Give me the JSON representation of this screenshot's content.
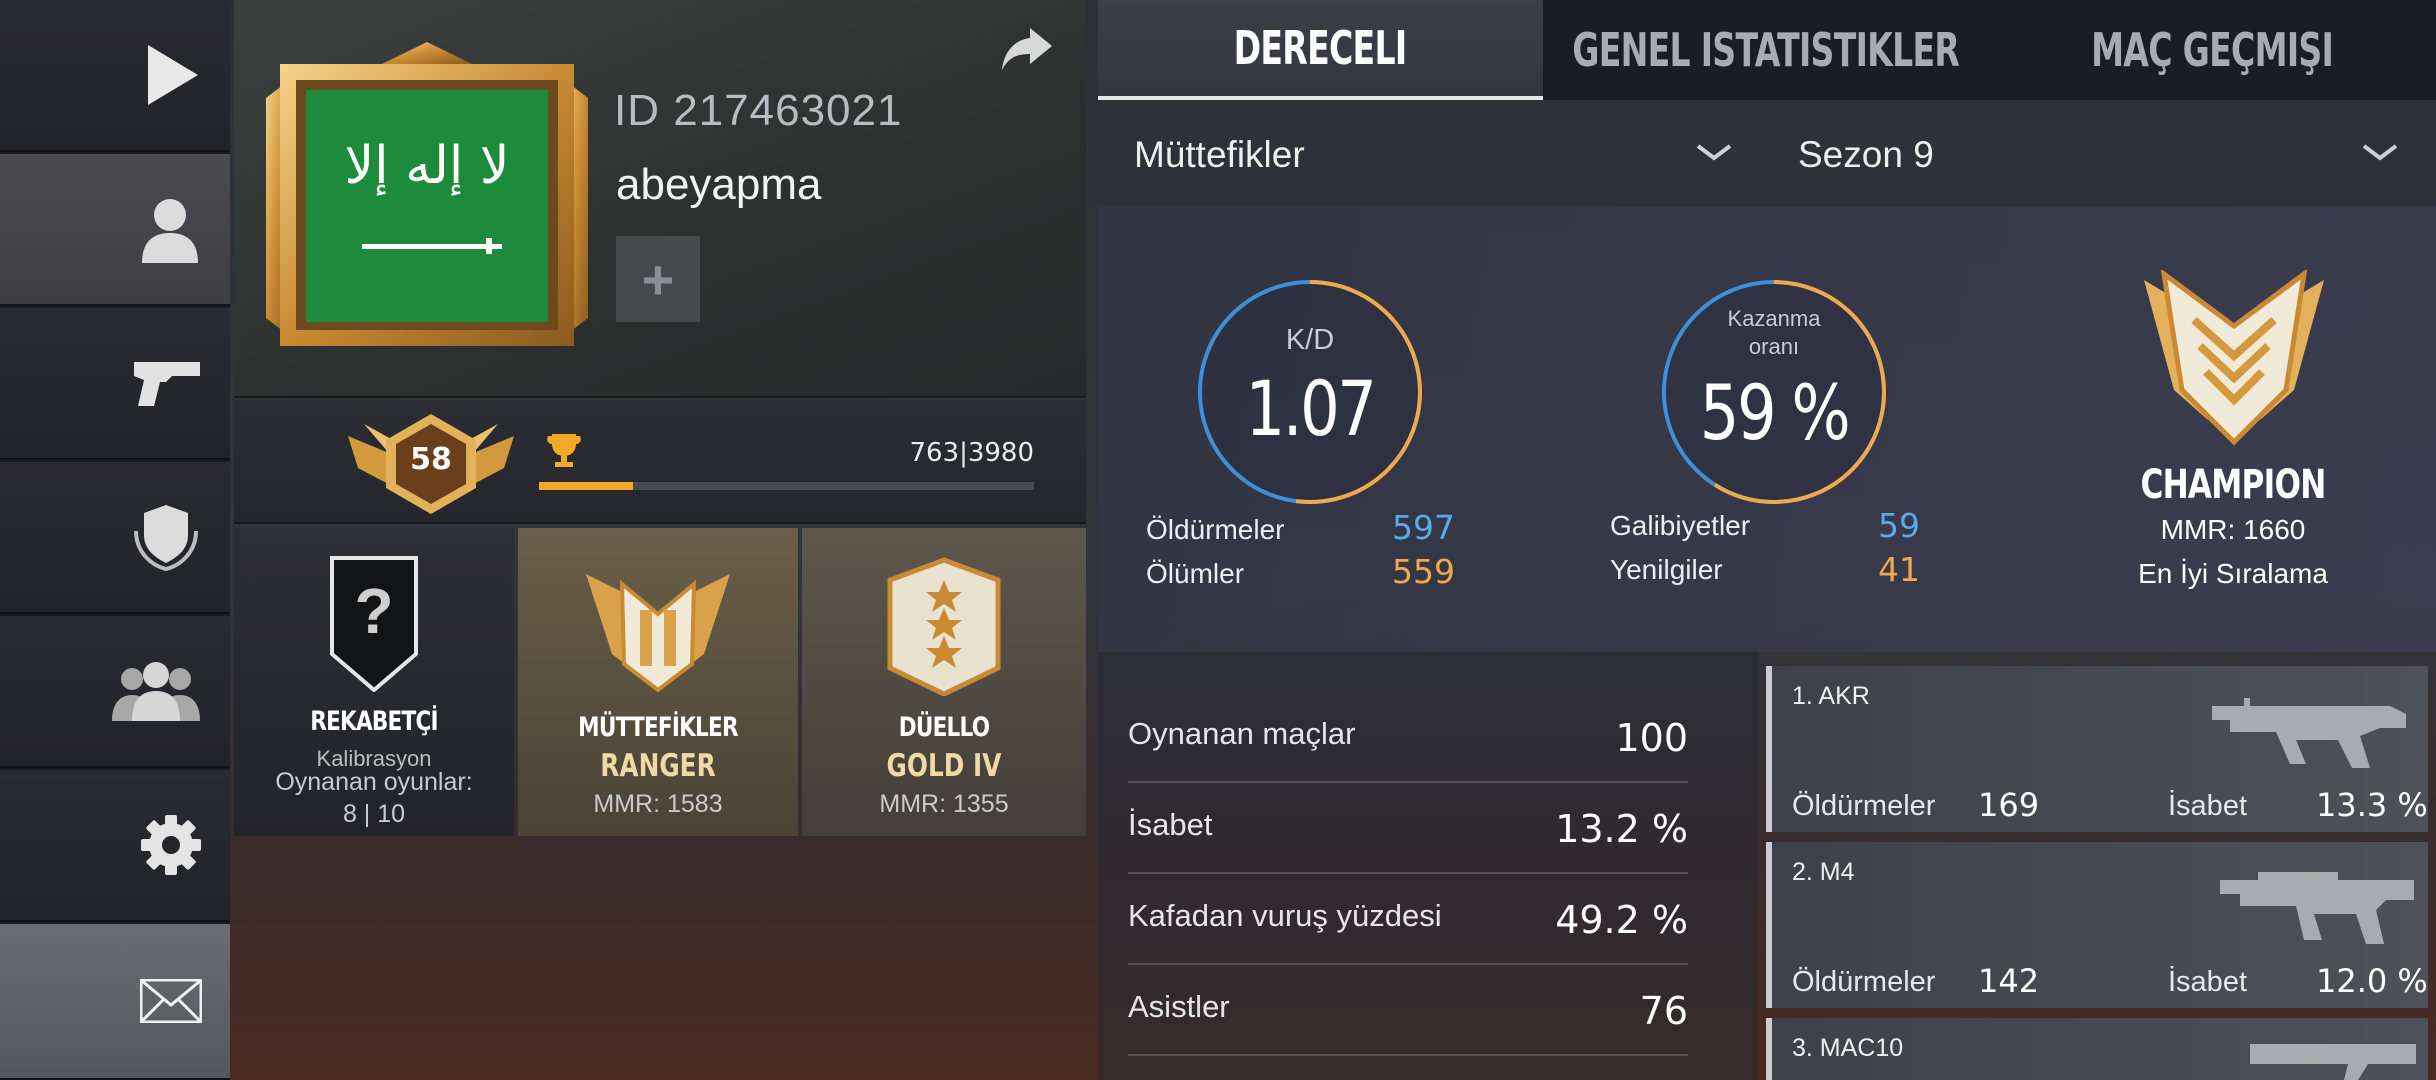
{
  "nav": {
    "items": [
      {
        "name": "play",
        "icon": "play-icon"
      },
      {
        "name": "profile",
        "icon": "person-icon",
        "active": true
      },
      {
        "name": "weapons",
        "icon": "pistol-icon"
      },
      {
        "name": "clan",
        "icon": "shield-laurel-icon"
      },
      {
        "name": "friends",
        "icon": "group-icon"
      },
      {
        "name": "settings",
        "icon": "gear-icon"
      },
      {
        "name": "mail",
        "icon": "envelope-icon"
      }
    ]
  },
  "profile": {
    "id_text": "ID 217463021",
    "name": "abeyapma",
    "add_label": "+",
    "level": "58",
    "xp_text": "763|3980",
    "xp_progress": 0.19
  },
  "ranks": {
    "rekabetci": {
      "title": "REKABETÇİ",
      "status": "Kalibrasyon",
      "games_label": "Oynanan oyunlar:",
      "games_value": "8 | 10",
      "badge": "?"
    },
    "muttefikler": {
      "title": "MÜTTEFİKLER",
      "rank": "RANGER",
      "mmr": "MMR: 1583"
    },
    "duello": {
      "title": "DÜELLO",
      "rank": "GOLD IV",
      "mmr": "MMR: 1355"
    }
  },
  "tabs": [
    {
      "label": "DERECELI",
      "active": true
    },
    {
      "label": "GENEL ISTATISTIKLER",
      "active": false
    },
    {
      "label": "MAÇ GEÇMIŞI",
      "active": false
    }
  ],
  "filters": {
    "mode": "Müttefikler",
    "season": "Sezon 9"
  },
  "summary": {
    "kd_label": "K/D",
    "kd_value": "1.07",
    "kd_fraction": 0.52,
    "win_label_1": "Kazanma",
    "win_label_2": "oranı",
    "win_value": "59 %",
    "win_fraction": 0.59,
    "kills_label": "Öldürmeler",
    "kills_value": "597",
    "deaths_label": "Ölümler",
    "deaths_value": "559",
    "wins_label": "Galibiyetler",
    "wins_value": "59",
    "losses_label": "Yenilgiler",
    "losses_value": "41",
    "best_rank": "CHAMPION",
    "best_mmr": "MMR: 1660",
    "best_label": "En İyi Sıralama"
  },
  "details": [
    {
      "label": "Oynanan maçlar",
      "value": "100"
    },
    {
      "label": "İsabet",
      "value": "13.2 %"
    },
    {
      "label": "Kafadan vuruş yüzdesi",
      "value": "49.2 %"
    },
    {
      "label": "Asistler",
      "value": "76"
    }
  ],
  "weapons": [
    {
      "name": "1. AKR",
      "kills_label": "Öldürmeler",
      "kills": "169",
      "acc_label": "İsabet",
      "acc": "13.3 %"
    },
    {
      "name": "2. M4",
      "kills_label": "Öldürmeler",
      "kills": "142",
      "acc_label": "İsabet",
      "acc": "12.0 %"
    },
    {
      "name": "3. MAC10"
    }
  ],
  "colors": {
    "accent_orange": "#f3a82a",
    "kd_blue": "#5aa9e8",
    "flag_green": "#1e8a3c",
    "gold": "#d9a24a"
  }
}
